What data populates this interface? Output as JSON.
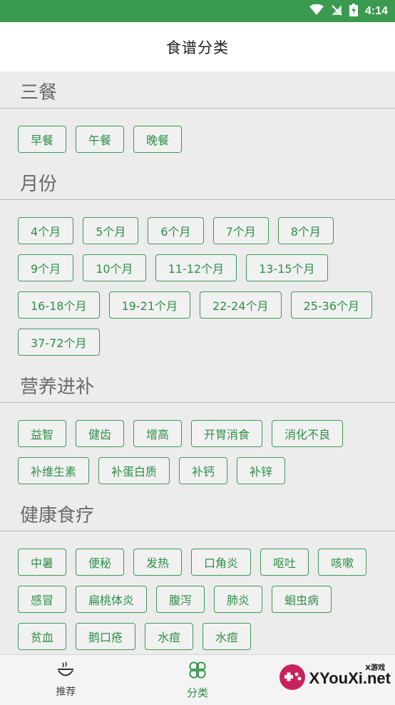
{
  "status_bar": {
    "time": "4:14"
  },
  "app_bar": {
    "title": "食谱分类"
  },
  "sections": [
    {
      "title": "三餐",
      "items": [
        "早餐",
        "午餐",
        "晚餐"
      ]
    },
    {
      "title": "月份",
      "items": [
        "4个月",
        "5个月",
        "6个月",
        "7个月",
        "8个月",
        "9个月",
        "10个月",
        "11-12个月",
        "13-15个月",
        "16-18个月",
        "19-21个月",
        "22-24个月",
        "25-36个月",
        "37-72个月"
      ]
    },
    {
      "title": "营养进补",
      "items": [
        "益智",
        "健齿",
        "增高",
        "开胃消食",
        "消化不良",
        "补维生素",
        "补蛋白质",
        "补钙",
        "补锌"
      ]
    },
    {
      "title": "健康食疗",
      "items": [
        "中暑",
        "便秘",
        "发热",
        "口角炎",
        "呕吐",
        "咳嗽",
        "感冒",
        "扁桃体炎",
        "腹泻",
        "肺炎",
        "蛔虫病",
        "贫血",
        "鹅口疮",
        "水痘",
        "水痘"
      ]
    }
  ],
  "bottom_nav": {
    "items": [
      {
        "label": "推荐",
        "icon": "bowl-icon"
      },
      {
        "label": "分类",
        "icon": "clover-grid-icon"
      }
    ]
  },
  "watermark": {
    "text": "XYouXi.net",
    "small": "X游戏"
  },
  "colors": {
    "status_bar": "#3a9a4f",
    "accent": "#2d8f47",
    "chip_border": "#3d9a56"
  }
}
